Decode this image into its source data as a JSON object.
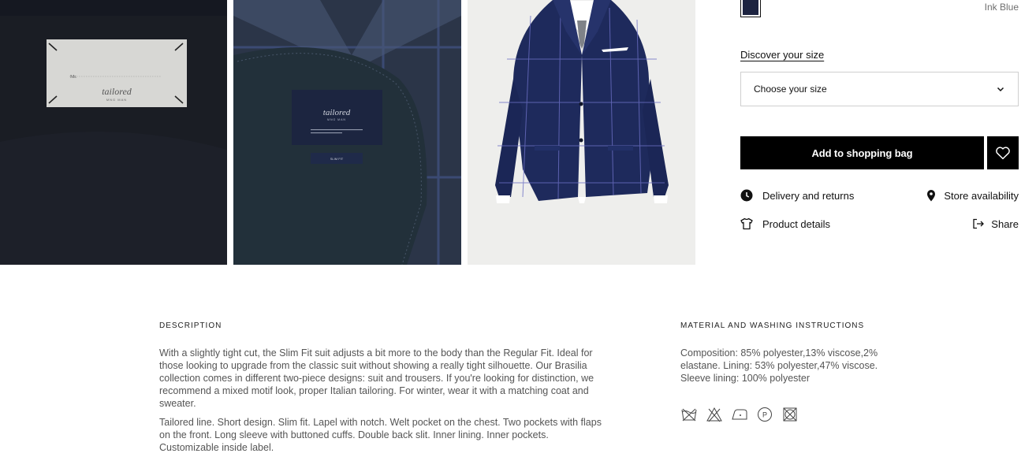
{
  "product": {
    "color_name": "Ink Blue",
    "color_hex": "#1c2340",
    "discover_size_label": "Discover your size",
    "size_select_label": "Choose your size",
    "add_to_bag_label": "Add to shopping bag",
    "links": {
      "delivery": "Delivery and returns",
      "store": "Store availability",
      "details": "Product details",
      "share": "Share"
    }
  },
  "gallery": {
    "images": [
      {
        "icon": "suit-inner-label-photo",
        "label_text": "Mr.",
        "brand": "tailored",
        "sub": "MNG MAN"
      },
      {
        "icon": "suit-lining-label-photo",
        "brand": "tailored",
        "sub": "MNG MAN",
        "tag": "SLIM FIT"
      },
      {
        "icon": "suit-jacket-photo"
      }
    ]
  },
  "description": {
    "title": "DESCRIPTION",
    "paragraph_1": "With a slightly tight cut, the Slim Fit suit adjusts a bit more to the body than the Regular Fit. Ideal for those looking to upgrade from the classic suit without showing a really tight silhouette. Our Brasilia collection comes in different two-piece designs: suit and trousers. If you're looking for distinction, we recommend a mixed motif look, proper Italian tailoring. For winter, wear it with a matching coat and sweater.",
    "paragraph_2": "Tailored line. Short design. Slim fit. Lapel with notch. Welt pocket on the chest. Two pockets with flaps on the front. Long sleeve with buttoned cuffs. Double back slit. Inner lining. Inner pockets. Customizable inside label."
  },
  "material": {
    "title": "MATERIAL AND WASHING INSTRUCTIONS",
    "composition": "Composition: 85% polyester,13% viscose,2% elastane. Lining: 53% polyester,47% viscose. Sleeve lining: 100% polyester",
    "care_icons": [
      "do-not-wash-icon",
      "do-not-bleach-icon",
      "iron-low-icon",
      "dry-clean-p-icon",
      "do-not-tumble-dry-icon"
    ],
    "care_label_p": "P"
  }
}
